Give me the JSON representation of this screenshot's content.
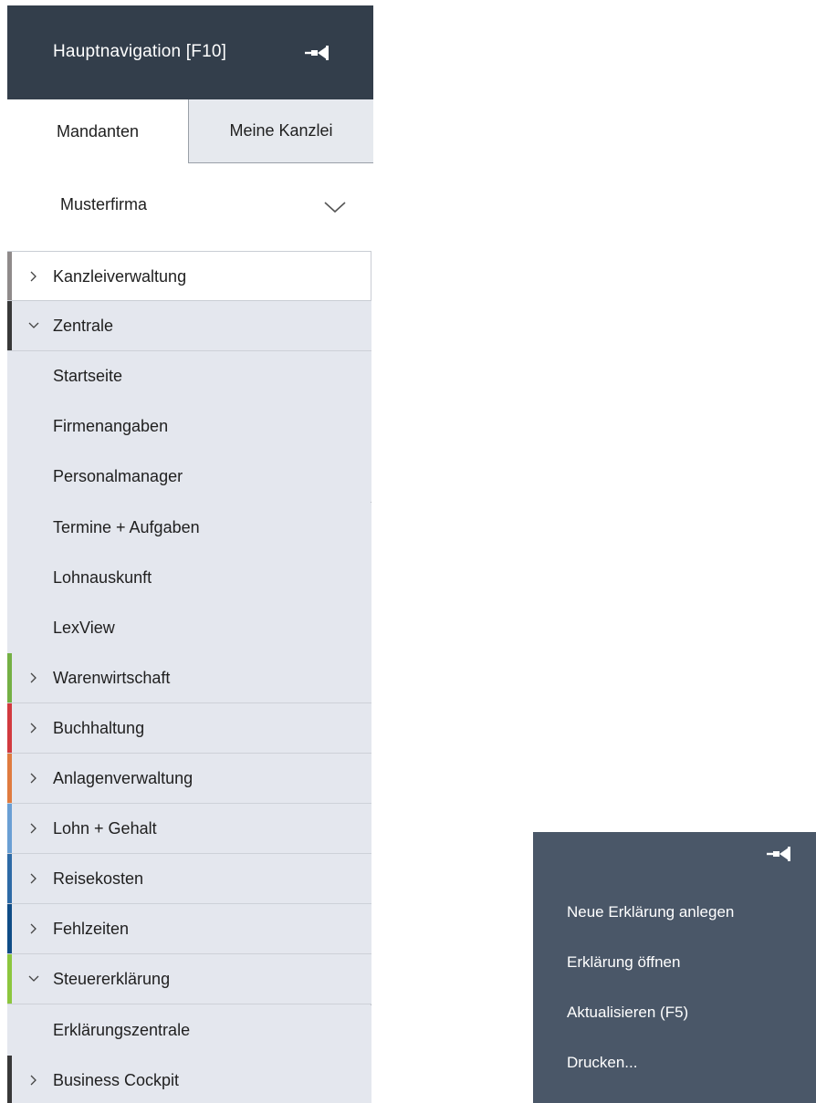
{
  "nav": {
    "title": "Hauptnavigation [F10]",
    "tabs": {
      "active": "Mandanten",
      "other": "Meine Kanzlei"
    },
    "client": {
      "selected": "Musterfirma"
    },
    "items": [
      {
        "label": "Kanzleiverwaltung",
        "type": "section",
        "expanded": false,
        "highlight": true,
        "color": "#8f8a8a"
      },
      {
        "label": "Zentrale",
        "type": "section",
        "expanded": true,
        "color": "#383838"
      },
      {
        "label": "Startseite",
        "type": "sub"
      },
      {
        "label": "Firmenangaben",
        "type": "sub"
      },
      {
        "label": "Personalmanager",
        "type": "sub"
      },
      {
        "label": "Termine + Aufgaben",
        "type": "sub"
      },
      {
        "label": "Lohnauskunft",
        "type": "sub"
      },
      {
        "label": "LexView",
        "type": "sub"
      },
      {
        "label": "Warenwirtschaft",
        "type": "section",
        "expanded": false,
        "color": "#74b044"
      },
      {
        "label": "Buchhaltung",
        "type": "section",
        "expanded": false,
        "color": "#d23a3f"
      },
      {
        "label": "Anlagenverwaltung",
        "type": "section",
        "expanded": false,
        "color": "#e07b3f"
      },
      {
        "label": "Lohn + Gehalt",
        "type": "section",
        "expanded": false,
        "color": "#6a9fd4"
      },
      {
        "label": "Reisekosten",
        "type": "section",
        "expanded": false,
        "color": "#2d6aa6"
      },
      {
        "label": "Fehlzeiten",
        "type": "section",
        "expanded": false,
        "color": "#0f4c86"
      },
      {
        "label": "Steuererklärung",
        "type": "section",
        "expanded": true,
        "color": "#8cc63e"
      },
      {
        "label": "Erklärungszentrale",
        "type": "sub"
      },
      {
        "label": "Business Cockpit",
        "type": "section",
        "expanded": false,
        "color": "#383838"
      }
    ]
  },
  "context_panel": {
    "items": [
      "Neue Erklärung anlegen",
      "Erklärung öffnen",
      "Aktualisieren (F5)",
      "Drucken..."
    ]
  },
  "icons": {
    "pin": "pin-icon",
    "dropdown": "chevron-down-icon",
    "collapsed": "chevron-right-icon",
    "expanded": "chevron-down-icon"
  }
}
